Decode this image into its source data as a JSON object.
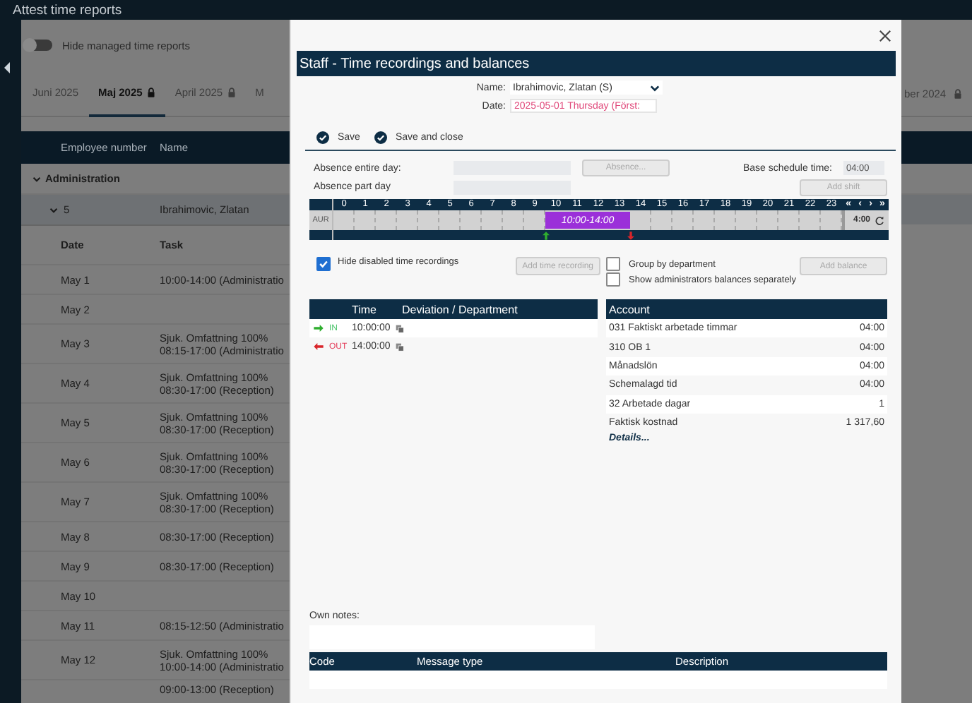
{
  "app": {
    "title": "Attest time reports"
  },
  "toggle": {
    "label": "Hide managed time reports",
    "on": false
  },
  "tabs": [
    {
      "label": "Juni 2025",
      "locked": false,
      "selected": false
    },
    {
      "label": "Maj 2025",
      "locked": true,
      "selected": true
    },
    {
      "label": "April 2025",
      "locked": true,
      "selected": false
    },
    {
      "label": "M",
      "locked": false,
      "selected": false
    }
  ],
  "tab_right": {
    "label": "ber 2024",
    "locked": true
  },
  "table": {
    "columns": [
      "Employee number",
      "Name"
    ],
    "group": {
      "label": "Administration",
      "expanded": true
    },
    "employee": {
      "number": "5",
      "name": "Ibrahimovic, Zlatan",
      "expanded": true
    },
    "sub_columns": [
      "Date",
      "Task"
    ],
    "rows": [
      {
        "date": "May 1",
        "task": [
          "10:00-14:00 (Administratio"
        ]
      },
      {
        "date": "May 2"
      },
      {
        "date": "May 3",
        "task": [
          "Sjuk. Omfattning 100%",
          "08:15-17:00 (Administratio"
        ]
      },
      {
        "date": "May 4",
        "task": [
          "Sjuk. Omfattning 100%",
          "08:30-17:00 (Reception)"
        ]
      },
      {
        "date": "May 5",
        "task": [
          "Sjuk. Omfattning 100%",
          "08:30-17:00 (Reception)"
        ]
      },
      {
        "date": "May 6",
        "task": [
          "Sjuk. Omfattning 100%",
          "08:30-17:00 (Reception)"
        ]
      },
      {
        "date": "May 7",
        "task": [
          "Sjuk. Omfattning 100%",
          "08:30-17:00 (Reception)"
        ]
      },
      {
        "date": "May 8",
        "task": [
          "08:30-17:00 (Reception)"
        ]
      },
      {
        "date": "May 9",
        "task": [
          "08:30-17:00 (Reception)"
        ]
      },
      {
        "date": "May 10"
      },
      {
        "date": "May 11",
        "task": [
          "08:15-12:50 (Administratio"
        ]
      },
      {
        "date": "May 12",
        "task": [
          "Sjuk. Omfattning 100%",
          "10:00-14:00 (Administratio"
        ]
      },
      {
        "task": [
          "09:00-13:00 (Reception)"
        ]
      }
    ]
  },
  "dialog": {
    "title": "Staff - Time recordings and balances",
    "name_label": "Name:",
    "name_value": "Ibrahimovic, Zlatan (S)",
    "date_label": "Date:",
    "date_value": "2025-05-01 Thursday (Först:",
    "actions": [
      "Save",
      "Save and close"
    ],
    "absence_entire_label": "Absence entire day:",
    "absence_part_label": "Absence part day",
    "absence_button": {
      "label": "Absence...",
      "disabled": true
    },
    "base_schedule_label": "Base schedule time:",
    "base_schedule_value": "04:00",
    "add_shift_button": {
      "label": "Add shift",
      "disabled": true
    },
    "timeline": {
      "row_label": "AUR",
      "shift_label": "10:00-14:00",
      "total": "4:00",
      "nav": [
        "«",
        "‹",
        "›",
        "»"
      ],
      "slots": [
        {
          "hour": "0",
          "scheduled": false
        },
        {
          "hour": "1",
          "scheduled": false
        },
        {
          "hour": "2",
          "scheduled": false
        },
        {
          "hour": "3",
          "scheduled": false
        },
        {
          "hour": "4",
          "scheduled": false
        },
        {
          "hour": "5",
          "scheduled": false
        },
        {
          "hour": "6",
          "scheduled": false
        },
        {
          "hour": "7",
          "scheduled": false
        },
        {
          "hour": "8",
          "scheduled": false
        },
        {
          "hour": "9",
          "scheduled": false
        },
        {
          "hour": "10",
          "scheduled": true,
          "clock_in": true
        },
        {
          "hour": "11",
          "scheduled": true
        },
        {
          "hour": "12",
          "scheduled": true
        },
        {
          "hour": "13",
          "scheduled": true
        },
        {
          "hour": "14",
          "scheduled": false,
          "clock_out": true
        },
        {
          "hour": "15",
          "scheduled": false
        },
        {
          "hour": "16",
          "scheduled": false
        },
        {
          "hour": "17",
          "scheduled": false
        },
        {
          "hour": "18",
          "scheduled": false
        },
        {
          "hour": "19",
          "scheduled": false
        },
        {
          "hour": "20",
          "scheduled": false
        },
        {
          "hour": "21",
          "scheduled": false
        },
        {
          "hour": "22",
          "scheduled": false
        },
        {
          "hour": "23",
          "scheduled": false
        }
      ]
    },
    "hide_disabled": {
      "label": "Hide disabled time recordings",
      "checked": true
    },
    "add_recording_button": {
      "label": "Add time recording",
      "disabled": true
    },
    "group_by_department": {
      "label": "Group by department",
      "checked": false
    },
    "show_admin_balances": {
      "label": "Show administrators balances separately",
      "checked": false
    },
    "add_balance_button": {
      "label": "Add balance",
      "disabled": true
    },
    "recordings": {
      "columns": [
        "Time",
        "Deviation / Department"
      ],
      "rows": [
        {
          "kind": "in",
          "direction": "IN",
          "time": "10:00:00"
        },
        {
          "kind": "out",
          "direction": "OUT",
          "time": "14:00:00"
        }
      ]
    },
    "accounts": {
      "column": "Account",
      "rows": [
        {
          "name": "031 Faktiskt arbetade timmar",
          "value": "04:00"
        },
        {
          "name": "310 OB 1",
          "value": "04:00"
        },
        {
          "name": "Månadslön",
          "value": "04:00"
        },
        {
          "name": "Schemalagd tid",
          "value": "04:00"
        },
        {
          "name": "32 Arbetade dagar",
          "value": "1"
        },
        {
          "name": "Faktisk kostnad",
          "value": "1 317,60"
        }
      ],
      "link": "Details..."
    },
    "notes_label": "Own notes:",
    "messages": {
      "columns": [
        "Code",
        "Message type",
        "Description"
      ]
    }
  }
}
